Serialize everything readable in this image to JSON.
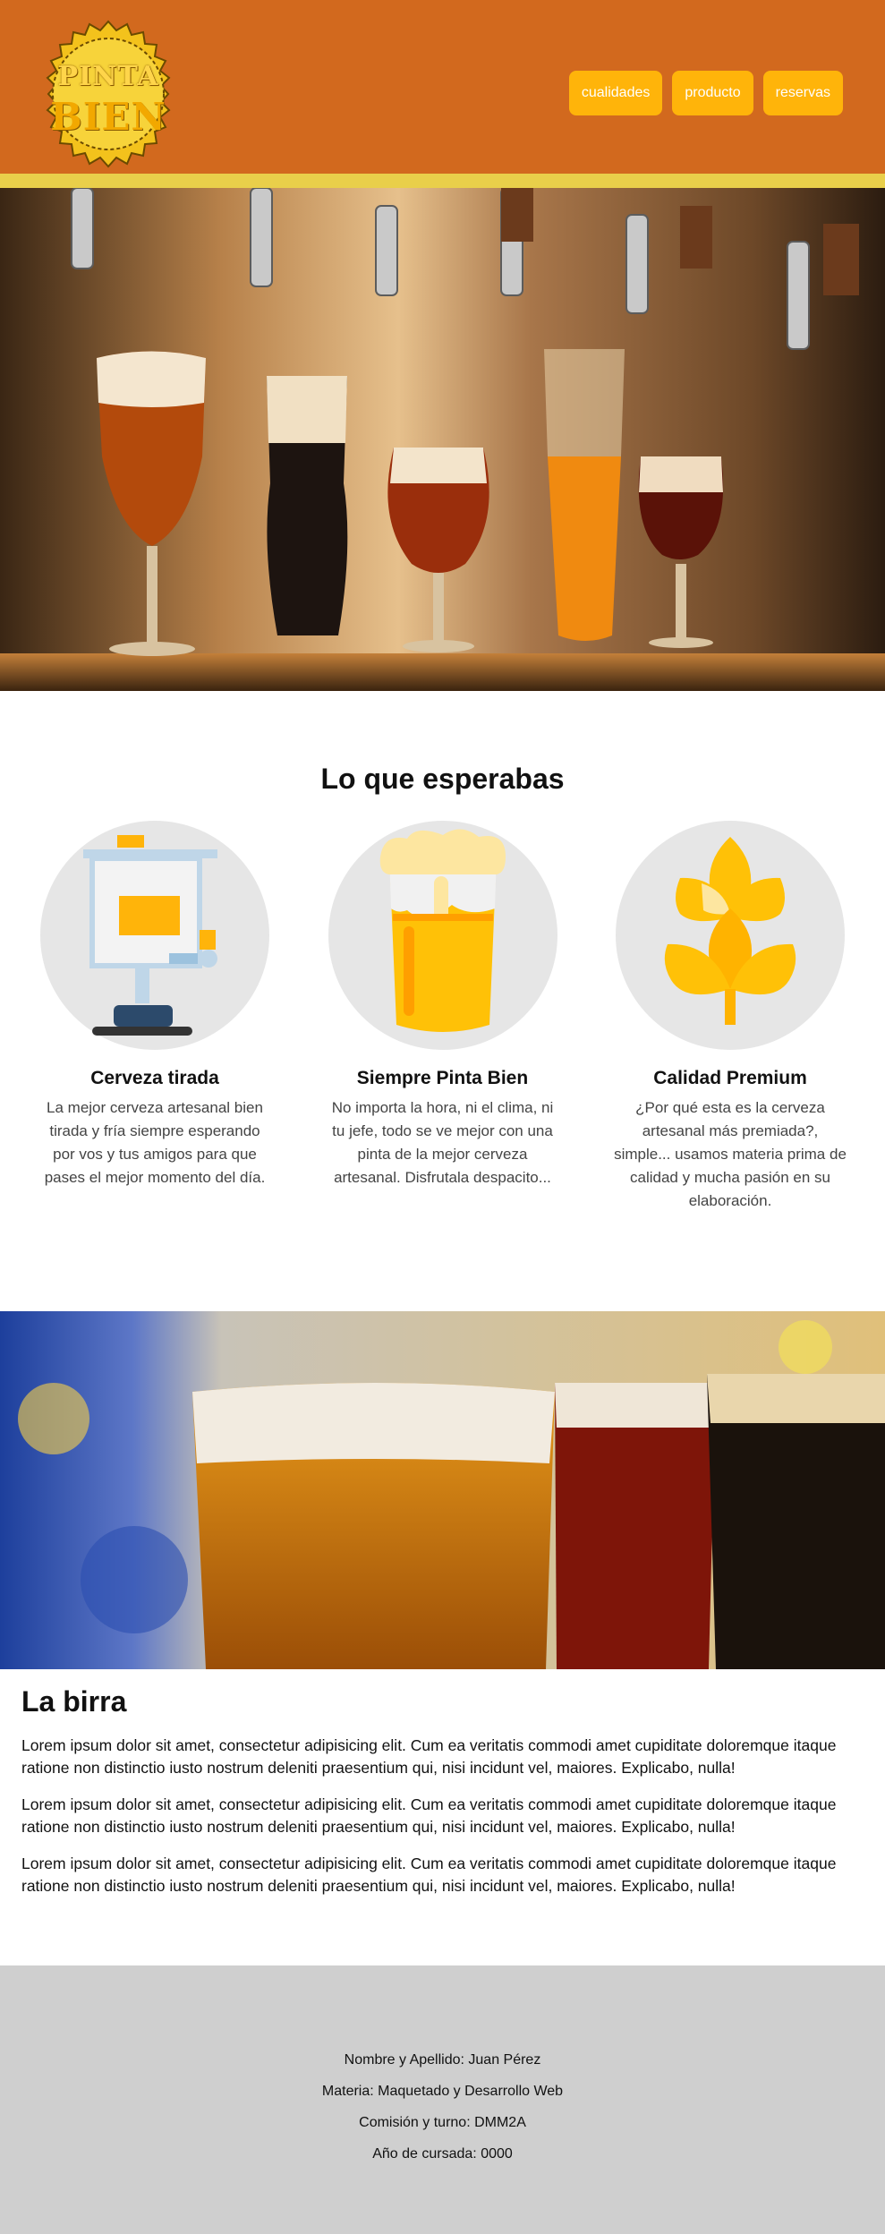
{
  "header": {
    "logo": {
      "line1": "PINTA",
      "line2": "BIEN"
    },
    "nav": [
      {
        "label": "cualidades"
      },
      {
        "label": "producto"
      },
      {
        "label": "reservas"
      }
    ]
  },
  "features": {
    "title": "Lo que esperabas",
    "items": [
      {
        "icon": "beer-dispenser-icon",
        "title": "Cerveza tirada",
        "text": "La mejor cerveza artesanal bien tirada y fría siempre esperando por vos y tus amigos para que pases el mejor momento del día."
      },
      {
        "icon": "beer-glass-icon",
        "title": "Siempre Pinta Bien",
        "text": "No importa la hora, ni el clima, ni tu jefe, todo se ve mejor con una pinta de la mejor cerveza artesanal. Disfrutala despacito..."
      },
      {
        "icon": "wheat-icon",
        "title": "Calidad Premium",
        "text": "¿Por qué esta es la cerveza artesanal más premiada?, simple... usamos materia prima de calidad y mucha pasión en su elaboración."
      }
    ]
  },
  "article": {
    "title": "La birra",
    "paragraphs": [
      "Lorem ipsum dolor sit amet, consectetur adipisicing elit. Cum ea veritatis commodi amet cupiditate doloremque itaque ratione non distinctio iusto nostrum deleniti praesentium qui, nisi incidunt vel, maiores. Explicabo, nulla!",
      "Lorem ipsum dolor sit amet, consectetur adipisicing elit. Cum ea veritatis commodi amet cupiditate doloremque itaque ratione non distinctio iusto nostrum deleniti praesentium qui, nisi incidunt vel, maiores. Explicabo, nulla!",
      "Lorem ipsum dolor sit amet, consectetur adipisicing elit. Cum ea veritatis commodi amet cupiditate doloremque itaque ratione non distinctio iusto nostrum deleniti praesentium qui, nisi incidunt vel, maiores. Explicabo, nulla!"
    ]
  },
  "footer": {
    "lines": [
      "Nombre y Apellido: Juan Pérez",
      "Materia: Maquetado y Desarrollo Web",
      "Comisión y turno: DMM2A",
      "Año de cursada: 0000"
    ]
  },
  "colors": {
    "header_bg": "#d2691e",
    "header_stripe": "#e9cf4a",
    "nav_button": "#ffb40a",
    "footer_bg": "#cfcfcf"
  }
}
